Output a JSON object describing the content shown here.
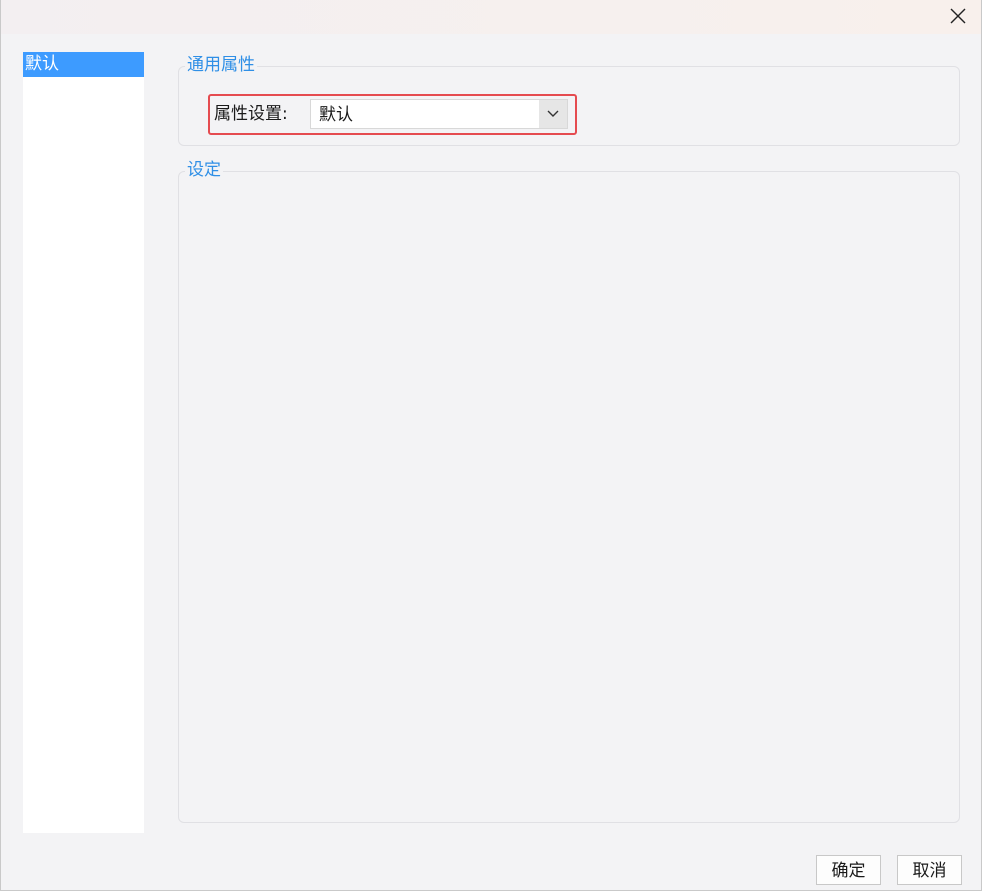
{
  "dialog": {
    "close_icon": "close-icon"
  },
  "left_list": {
    "items": [
      {
        "label": "默认",
        "selected": true
      }
    ]
  },
  "general_group": {
    "title": "通用属性",
    "property_label": "属性设置:",
    "property_value": "默认",
    "dropdown_icon": "chevron-down-icon"
  },
  "settings_group": {
    "title": "设定"
  },
  "footer": {
    "ok_label": "确定",
    "cancel_label": "取消"
  },
  "colors": {
    "accent": "#3d9bff",
    "group_title": "#2f8fe6",
    "highlight_border": "#e54b50"
  }
}
